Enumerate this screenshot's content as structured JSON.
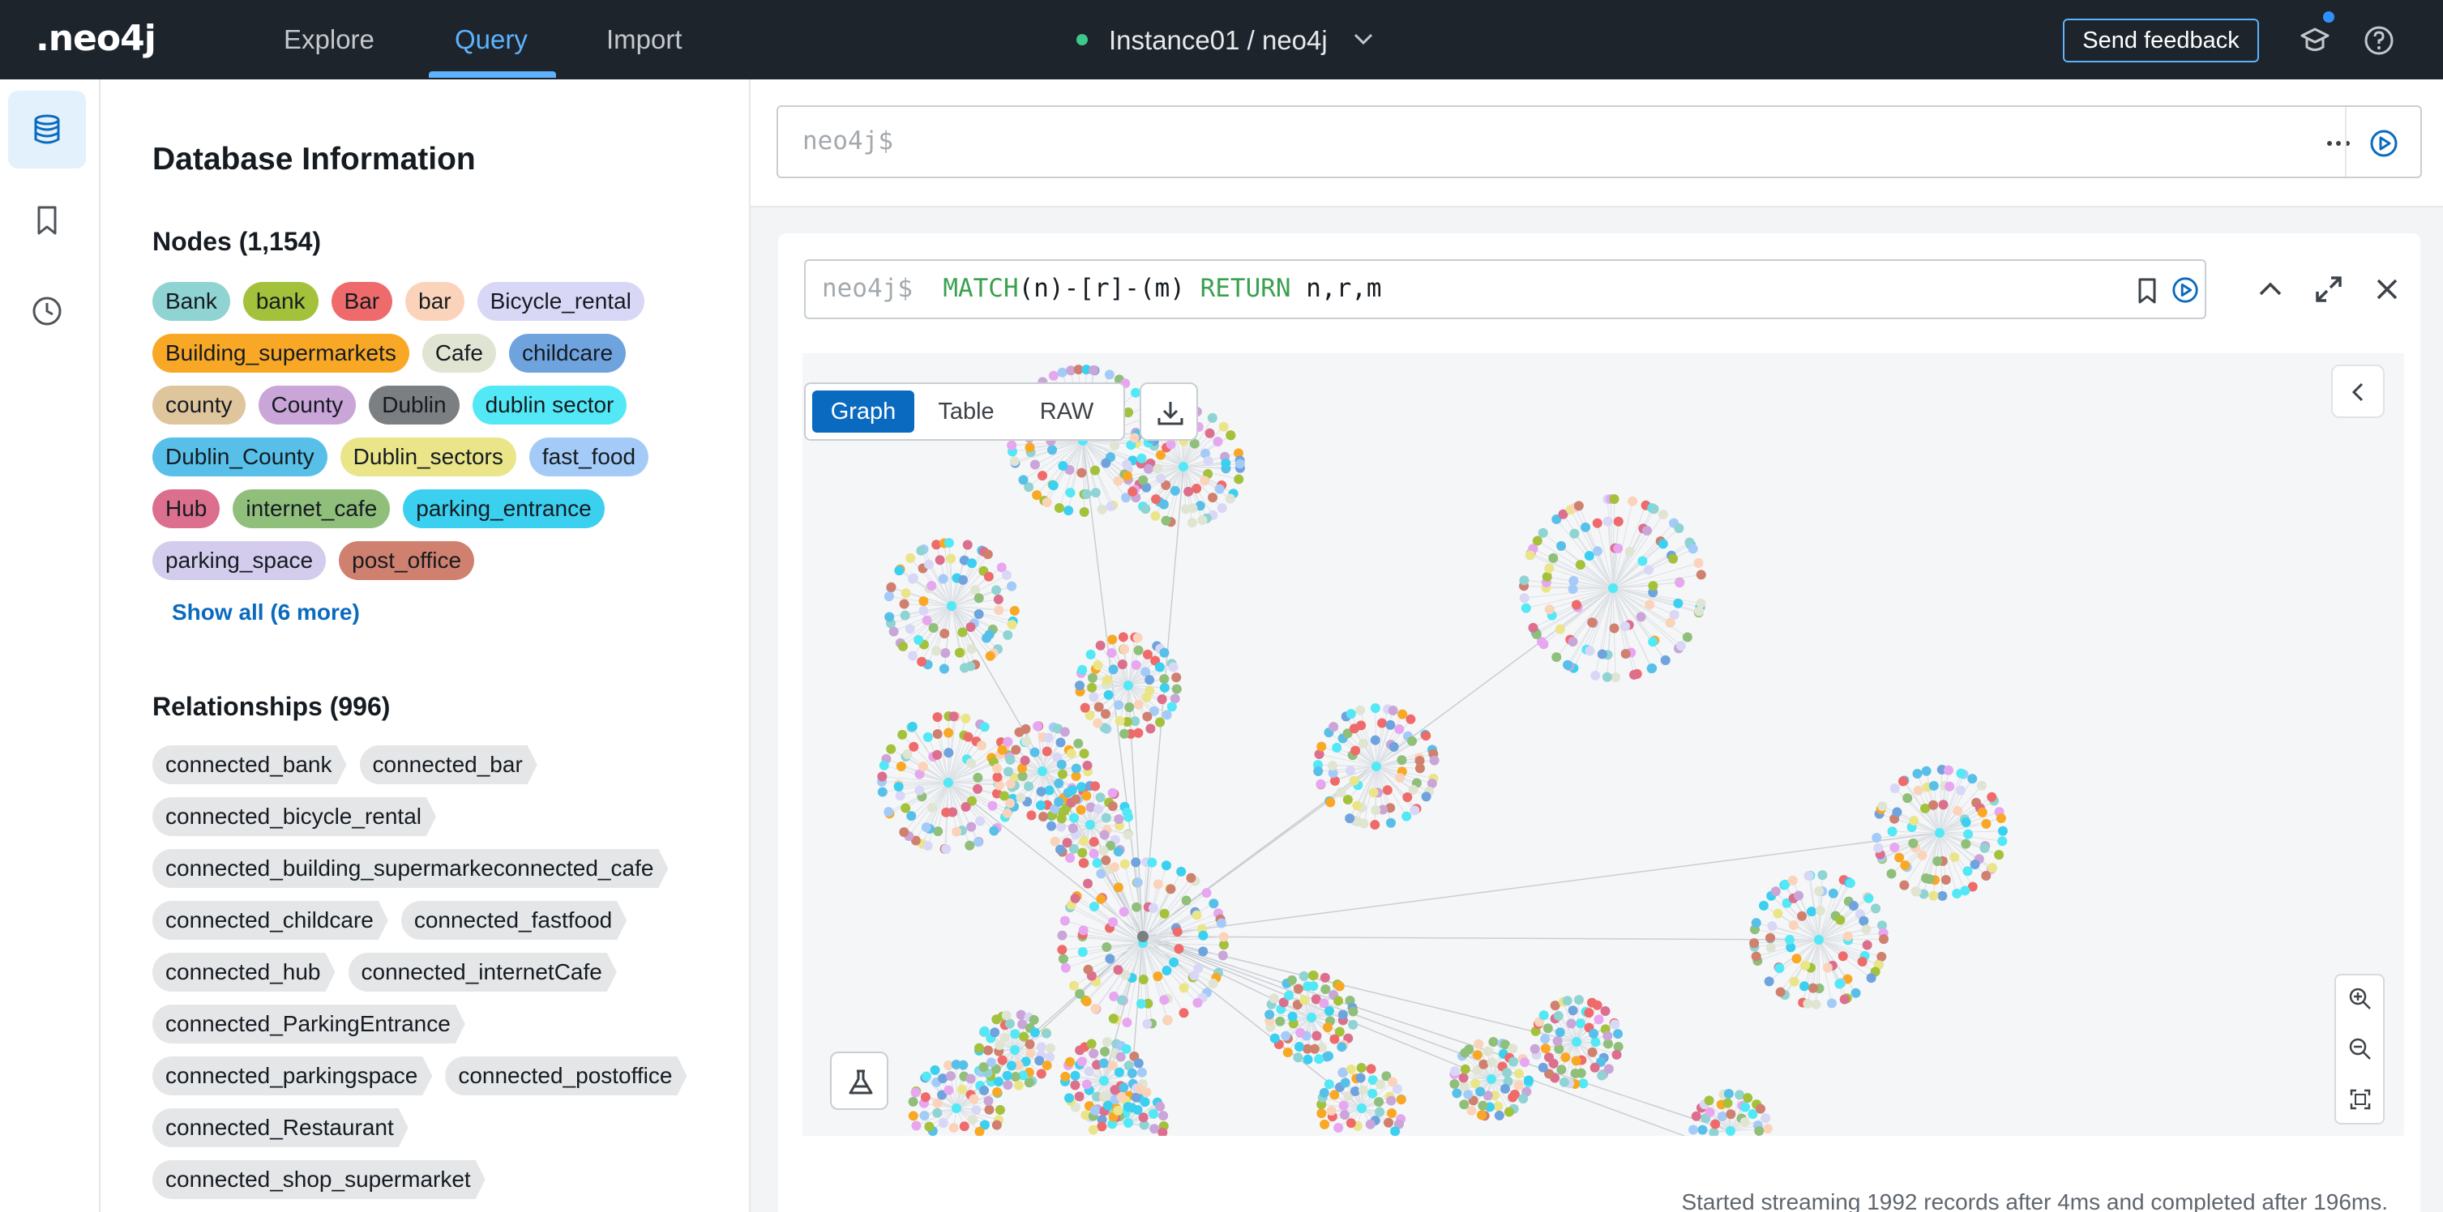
{
  "app": {
    "logo": ".neo4j"
  },
  "nav": {
    "tabs": [
      "Explore",
      "Query",
      "Import"
    ],
    "active": "Query"
  },
  "instance": {
    "label": "Instance01 / neo4j",
    "status_color": "#3ec98a"
  },
  "header": {
    "feedback_label": "Send feedback"
  },
  "db_info": {
    "title": "Database Information",
    "nodes_heading": "Nodes (1,154)",
    "node_labels": [
      {
        "name": "Bank",
        "color": "#8fd3d2"
      },
      {
        "name": "bank",
        "color": "#a4c13b"
      },
      {
        "name": "Bar",
        "color": "#ef6b6b"
      },
      {
        "name": "bar",
        "color": "#fbd3ba"
      },
      {
        "name": "Bicycle_rental",
        "color": "#d9d7f6"
      },
      {
        "name": "Building_supermarkets",
        "color": "#f9a825"
      },
      {
        "name": "Cafe",
        "color": "#e0e4d2"
      },
      {
        "name": "childcare",
        "color": "#6fa3de"
      },
      {
        "name": "county",
        "color": "#dfc59c"
      },
      {
        "name": "County",
        "color": "#caa5d8"
      },
      {
        "name": "Dublin",
        "color": "#7b7f82"
      },
      {
        "name": "dublin sector",
        "color": "#53e8f5"
      },
      {
        "name": "Dublin_County",
        "color": "#58c0e8"
      },
      {
        "name": "Dublin_sectors",
        "color": "#ebe589"
      },
      {
        "name": "fast_food",
        "color": "#a4cbf7"
      },
      {
        "name": "Hub",
        "color": "#db6f8d"
      },
      {
        "name": "internet_cafe",
        "color": "#8fbf7a"
      },
      {
        "name": "parking_entrance",
        "color": "#3bd0f0"
      },
      {
        "name": "parking_space",
        "color": "#d3ccec"
      },
      {
        "name": "post_office",
        "color": "#d0806e"
      }
    ],
    "show_all": "Show all (6 more)",
    "relationships_heading": "Relationships (996)",
    "relationship_types": [
      "connected_bank",
      "connected_bar",
      "connected_bicycle_rental",
      "connected_building_supermarkeconnected_cafe",
      "connected_childcare",
      "connected_fastfood",
      "connected_hub",
      "connected_internetCafe",
      "connected_ParkingEntrance",
      "connected_parkingspace",
      "connected_postoffice",
      "connected_Restaurant",
      "connected_shop_supermarket"
    ]
  },
  "editor": {
    "prompt": "neo4j$"
  },
  "result": {
    "query_prompt": "neo4j$",
    "query_tokens": [
      {
        "t": "MATCH",
        "k": "kw"
      },
      {
        "t": "(n)-[r]-(m) ",
        "k": "plain"
      },
      {
        "t": "RETURN",
        "k": "kw"
      },
      {
        "t": " n,r,m",
        "k": "plain"
      }
    ],
    "view_tabs": [
      "Graph",
      "Table",
      "RAW"
    ],
    "active_view": "Graph",
    "status": "Started streaming 1992 records after 4ms and completed after 196ms."
  },
  "graph_palette": [
    "#8fd3d2",
    "#a4c13b",
    "#ef6b6b",
    "#fbd3ba",
    "#d9d7f6",
    "#f9a825",
    "#e0e4d2",
    "#6fa3de",
    "#caa5d8",
    "#53e8f5",
    "#58c0e8",
    "#ebe589",
    "#a4cbf7",
    "#db6f8d",
    "#8fbf7a",
    "#3bd0f0",
    "#e7a6f0",
    "#d0806e"
  ]
}
